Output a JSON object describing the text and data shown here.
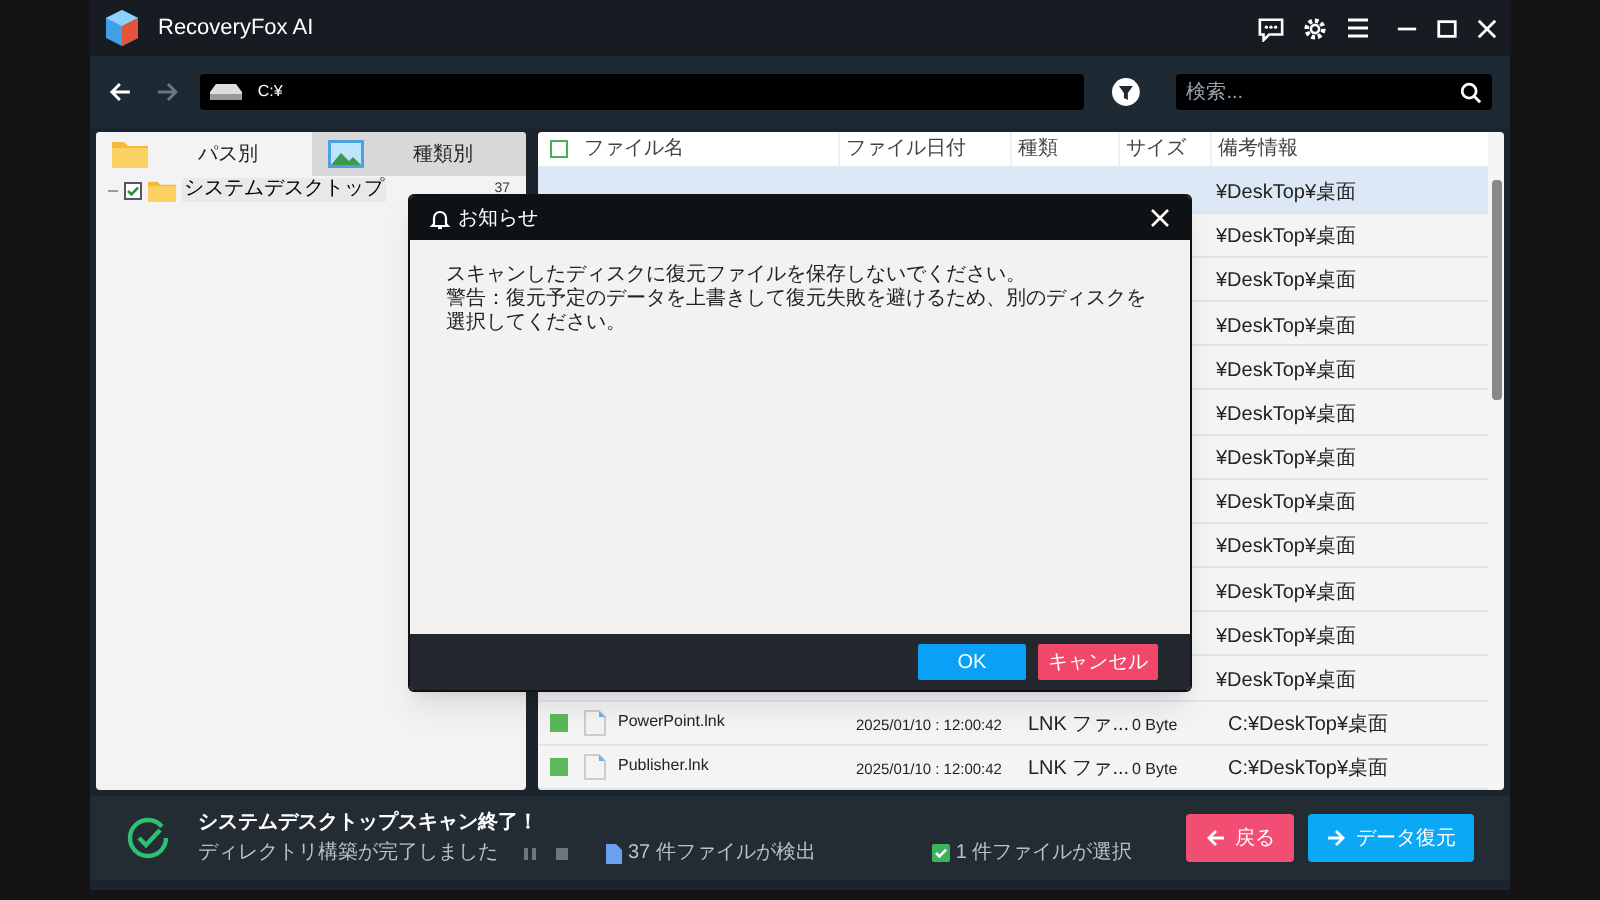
{
  "window": {
    "title": "RecoveryFox AI"
  },
  "toolbar": {
    "path": "C:¥",
    "search": {
      "placeholder": "検索..."
    }
  },
  "left_panel": {
    "tabs": [
      {
        "label": "パス別",
        "selected": false
      },
      {
        "label": "種類別",
        "selected": true
      }
    ],
    "tree": [
      {
        "label": "システムデスクトップ",
        "checked": true,
        "count": "37"
      }
    ]
  },
  "file_list": {
    "columns": [
      "ファイル名",
      "ファイル日付",
      "種類",
      "サイズ",
      "備考情報"
    ],
    "header_checked": false,
    "rows": [
      {
        "kind": "covered",
        "selected": true,
        "remark": "¥DeskTop¥桌面"
      },
      {
        "kind": "covered",
        "selected": false,
        "remark": "¥DeskTop¥桌面"
      },
      {
        "kind": "covered",
        "selected": false,
        "remark": "¥DeskTop¥桌面"
      },
      {
        "kind": "covered",
        "selected": false,
        "remark": "¥DeskTop¥桌面"
      },
      {
        "kind": "covered",
        "selected": false,
        "remark": "¥DeskTop¥桌面"
      },
      {
        "kind": "covered",
        "selected": false,
        "remark": "¥DeskTop¥桌面"
      },
      {
        "kind": "covered",
        "selected": false,
        "remark": "¥DeskTop¥桌面"
      },
      {
        "kind": "covered",
        "selected": false,
        "remark": "¥DeskTop¥桌面"
      },
      {
        "kind": "covered",
        "selected": false,
        "remark": "¥DeskTop¥桌面"
      },
      {
        "kind": "covered",
        "selected": false,
        "remark": "¥DeskTop¥桌面"
      },
      {
        "kind": "covered",
        "selected": false,
        "remark": "¥DeskTop¥桌面"
      },
      {
        "kind": "covered",
        "selected": false,
        "remark": "¥DeskTop¥桌面"
      },
      {
        "kind": "full",
        "selected": false,
        "checked": true,
        "name": "PowerPoint.lnk",
        "date": "2025/01/10 : 12:00:42",
        "type": "LNK ファ...",
        "size": "0 Byte",
        "remark": "C:¥DeskTop¥桌面"
      },
      {
        "kind": "full",
        "selected": false,
        "checked": true,
        "name": "Publisher.lnk",
        "date": "2025/01/10 : 12:00:42",
        "type": "LNK ファ...",
        "size": "0 Byte",
        "remark": "C:¥DeskTop¥桌面"
      }
    ]
  },
  "dialog": {
    "title": "お知らせ",
    "lines": [
      "スキャンしたディスクに復元ファイルを保存しないでください。",
      "警告：復元予定のデータを上書きして復元失敗を避けるため、別のディスクを選択してください。"
    ],
    "buttons": [
      {
        "label": "OK",
        "kind": "primary"
      },
      {
        "label": "キャンセル",
        "kind": "danger"
      }
    ]
  },
  "status": {
    "title": "システムデスクトップスキャン終了！",
    "message": "ディレクトリ構築が完了しました",
    "found": "37 件ファイルが検出",
    "selected_count": "1 件ファイルが選択",
    "buttons": [
      {
        "label": "戻る",
        "kind": "back"
      },
      {
        "label": "データ復元",
        "kind": "next"
      }
    ]
  }
}
